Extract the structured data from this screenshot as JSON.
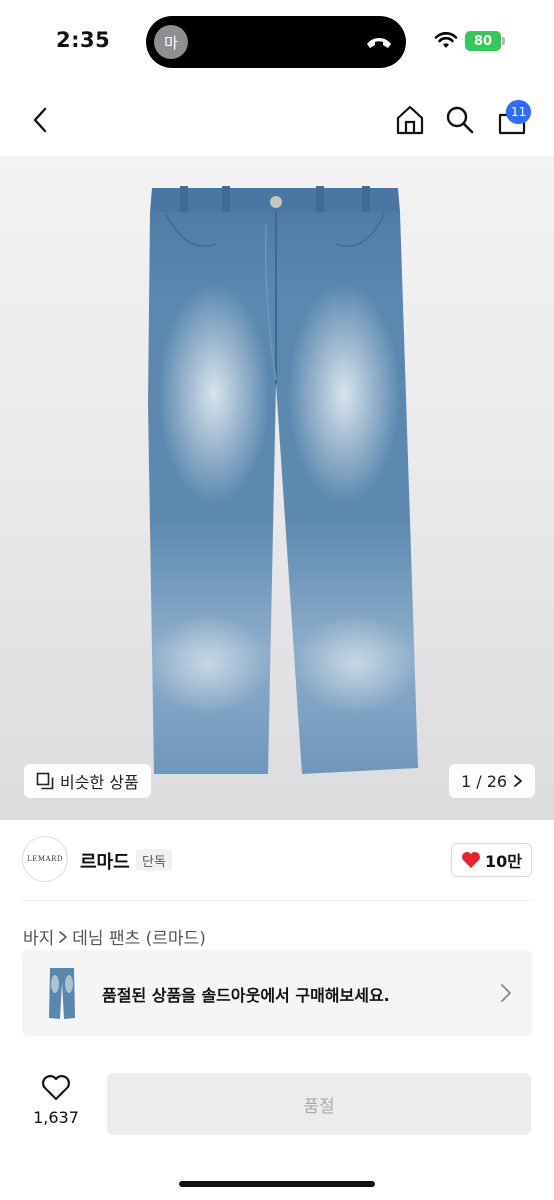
{
  "status_bar": {
    "time": "2:35",
    "caller_initial": "마",
    "battery_level": "80"
  },
  "nav": {
    "cart_badge": "11"
  },
  "product_image": {
    "similar_label": "비슷한 상품",
    "page_indicator": "1 / 26",
    "current_page": 1,
    "total_pages": 26
  },
  "brand": {
    "logo_text": "LEMARD",
    "name": "르마드",
    "exclusive_label": "단독",
    "likes_label": "10만"
  },
  "breadcrumb": {
    "category": "바지",
    "subcategory": "데님 팬츠 (르마드)"
  },
  "soldout_banner": {
    "text": "품절된 상품을 솔드아웃에서 구매해보세요."
  },
  "bottom_bar": {
    "like_count": "1,637",
    "primary_button": "품절"
  },
  "colors": {
    "accent_blue": "#2f6df6",
    "heart_red": "#e8262c",
    "battery_green": "#34c759",
    "denim": "#5b86ad"
  }
}
